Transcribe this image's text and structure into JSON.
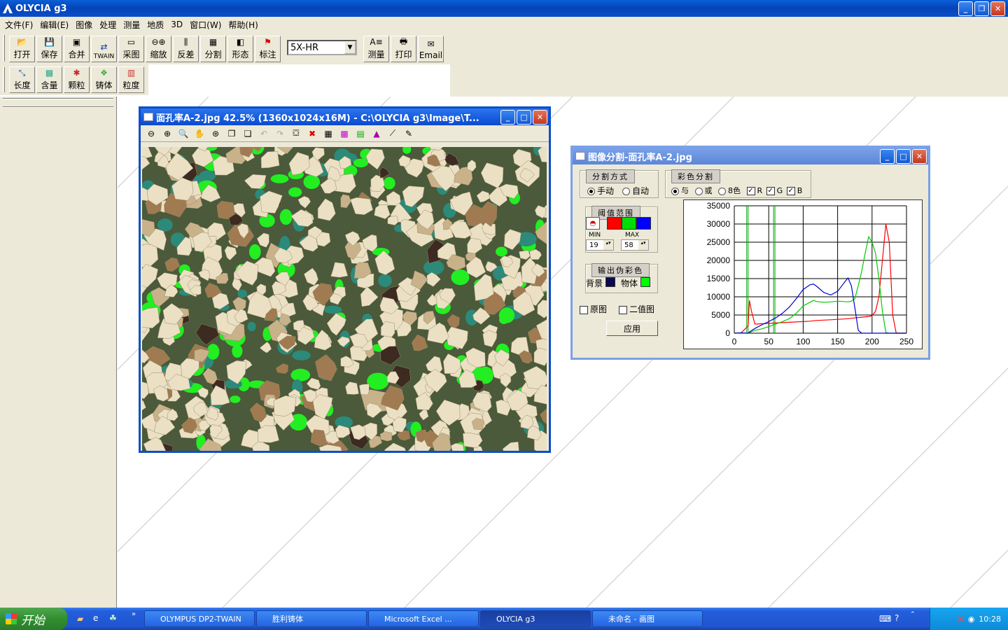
{
  "app": {
    "title": "OLYCIA g3"
  },
  "menu": [
    "文件(F)",
    "编辑(E)",
    "图像",
    "处理",
    "测量",
    "地质",
    "3D",
    "窗口(W)",
    "帮助(H)"
  ],
  "toolbar1": [
    {
      "label": "打开",
      "icon": "open-folder-icon"
    },
    {
      "label": "保存",
      "icon": "save-icon"
    },
    {
      "label": "合并",
      "icon": "merge-icon"
    },
    {
      "label": "TWAIN",
      "icon": "twain-icon"
    },
    {
      "label": "采图",
      "icon": "capture-icon"
    },
    {
      "label": "缩放",
      "icon": "zoom-icon"
    },
    {
      "label": "反差",
      "icon": "contrast-icon"
    },
    {
      "label": "分割",
      "icon": "segment-icon"
    },
    {
      "label": "形态",
      "icon": "morphology-icon"
    },
    {
      "label": "标注",
      "icon": "annotate-flag-icon"
    }
  ],
  "objective_select": "5X-HR",
  "toolbar1b": [
    {
      "label": "测量",
      "icon": "measure-icon"
    },
    {
      "label": "打印",
      "icon": "print-icon"
    },
    {
      "label": "Email",
      "icon": "email-icon"
    }
  ],
  "toolbar2": [
    {
      "label": "长度",
      "icon": "length-icon"
    },
    {
      "label": "含量",
      "icon": "content-icon"
    },
    {
      "label": "颗粒",
      "icon": "particle-icon"
    },
    {
      "label": "铸体",
      "icon": "cast-icon"
    },
    {
      "label": "粒度",
      "icon": "grain-size-icon"
    }
  ],
  "image_window": {
    "title": "面孔率A-2.jpg 42.5% (1360x1024x16M) - C:\\OLYCIA g3\\Image\\T..."
  },
  "seg_window": {
    "title": "图像分割-面孔率A-2.jpg",
    "method_group": "分割方式",
    "manual": "手动",
    "auto": "自动",
    "color_group": "彩色分割",
    "and": "与",
    "or": "或",
    "eight": "8色",
    "r": "R",
    "g": "G",
    "b": "B",
    "threshold_group": "阈值范围",
    "min_label": "MIN",
    "max_label": "MAX",
    "min_value": "19",
    "max_value": "58",
    "output_group": "输出伪彩色",
    "background": "背景",
    "object": "物体",
    "original": "原图",
    "binary": "二值图",
    "apply": "应用",
    "colors": {
      "bg": "#0a0a50",
      "obj": "#00ff00",
      "red": "#ff0000",
      "green": "#00dd00",
      "blue": "#0000ff"
    }
  },
  "chart_data": {
    "type": "line",
    "x": [
      0,
      10,
      20,
      22,
      25,
      30,
      40,
      50,
      60,
      70,
      80,
      90,
      100,
      110,
      115,
      120,
      130,
      140,
      150,
      160,
      165,
      170,
      175,
      180,
      185,
      190,
      195,
      200,
      205,
      210,
      215,
      220,
      225,
      230,
      235,
      240,
      250
    ],
    "series": [
      {
        "color": "#ff0000",
        "values": [
          0,
          100,
          2000,
          9000,
          6000,
          2500,
          2600,
          2700,
          2800,
          2900,
          3000,
          3100,
          3200,
          3300,
          3400,
          3500,
          3600,
          3700,
          3800,
          3900,
          4000,
          4100,
          4200,
          4300,
          4400,
          4500,
          4600,
          4800,
          6000,
          10000,
          20000,
          30000,
          25000,
          5000,
          100,
          0,
          0
        ]
      },
      {
        "color": "#00cc00",
        "values": [
          0,
          100,
          0,
          200,
          400,
          800,
          1200,
          1800,
          2500,
          3200,
          4000,
          5500,
          7500,
          8500,
          9000,
          8700,
          8500,
          8600,
          8800,
          8700,
          8600,
          8800,
          9500,
          13000,
          17000,
          22000,
          26500,
          25000,
          22000,
          15000,
          6000,
          200,
          0,
          0,
          0,
          0,
          0
        ]
      },
      {
        "color": "#0000cc",
        "values": [
          0,
          100,
          0,
          300,
          700,
          1300,
          2300,
          3200,
          4200,
          5500,
          7200,
          9500,
          12000,
          13300,
          13500,
          12800,
          11200,
          10500,
          11500,
          14000,
          15200,
          13000,
          7000,
          800,
          0,
          0,
          0,
          0,
          0,
          0,
          0,
          0,
          0,
          0,
          0,
          0,
          0
        ]
      }
    ],
    "vlines": [
      19,
      58
    ],
    "xlim": [
      0,
      250
    ],
    "ylim": [
      0,
      35000
    ],
    "xticks": [
      "0",
      "50",
      "100",
      "150",
      "200",
      "250"
    ],
    "yticks": [
      "35000",
      "30000",
      "25000",
      "20000",
      "15000",
      "10000",
      "5000",
      "0"
    ]
  },
  "taskbar": {
    "start": "开始",
    "tasks": [
      "OLYMPUS DP2-TWAIN",
      "胜利铸体",
      "Microsoft Excel ...",
      "OLYCIA g3",
      "未命名 - 画图"
    ],
    "clock": "10:28"
  }
}
